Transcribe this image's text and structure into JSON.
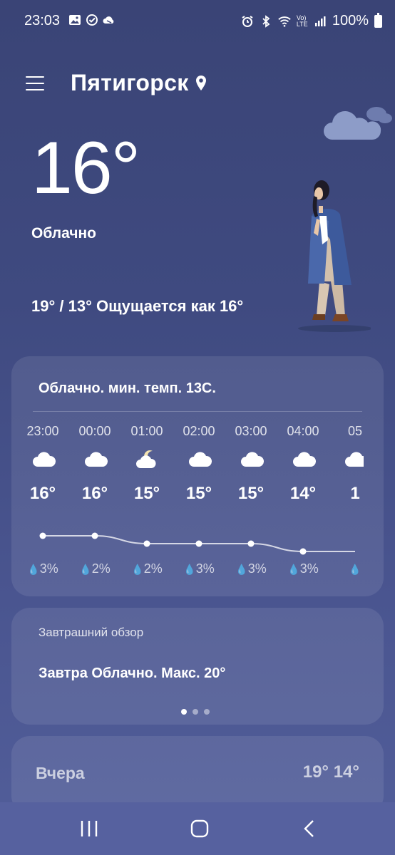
{
  "status_bar": {
    "time": "23:03",
    "battery": "100%",
    "network_label": "Vo) LTE"
  },
  "header": {
    "city": "Пятигорск"
  },
  "current": {
    "temperature": "16°",
    "condition": "Облачно",
    "minmax_feels": "19° / 13° Ощущается как 16°"
  },
  "hourly": {
    "summary": "Облачно. мин. темп. 13С.",
    "items": [
      {
        "time": "23:00",
        "temp": "16°",
        "temp_value": 16,
        "precip": "3%",
        "icon": "cloud-icon"
      },
      {
        "time": "00:00",
        "temp": "16°",
        "temp_value": 16,
        "precip": "2%",
        "icon": "cloud-icon"
      },
      {
        "time": "01:00",
        "temp": "15°",
        "temp_value": 15,
        "precip": "2%",
        "icon": "moon-cloud-icon"
      },
      {
        "time": "02:00",
        "temp": "15°",
        "temp_value": 15,
        "precip": "3%",
        "icon": "cloud-icon"
      },
      {
        "time": "03:00",
        "temp": "15°",
        "temp_value": 15,
        "precip": "3%",
        "icon": "cloud-icon"
      },
      {
        "time": "04:00",
        "temp": "14°",
        "temp_value": 14,
        "precip": "3%",
        "icon": "cloud-icon"
      },
      {
        "time": "05",
        "temp": "1",
        "temp_value": 14,
        "precip": "",
        "icon": "cloud-icon"
      }
    ]
  },
  "tomorrow": {
    "label": "Завтрашний обзор",
    "text": "Завтра Облачно. Макс. 20°"
  },
  "yesterday": {
    "label": "Вчера",
    "temps": "19° 14°"
  },
  "colors": {
    "bg_top": "#3a4476",
    "bg_bottom": "#525e9a",
    "coat": "#3d5a9c"
  }
}
